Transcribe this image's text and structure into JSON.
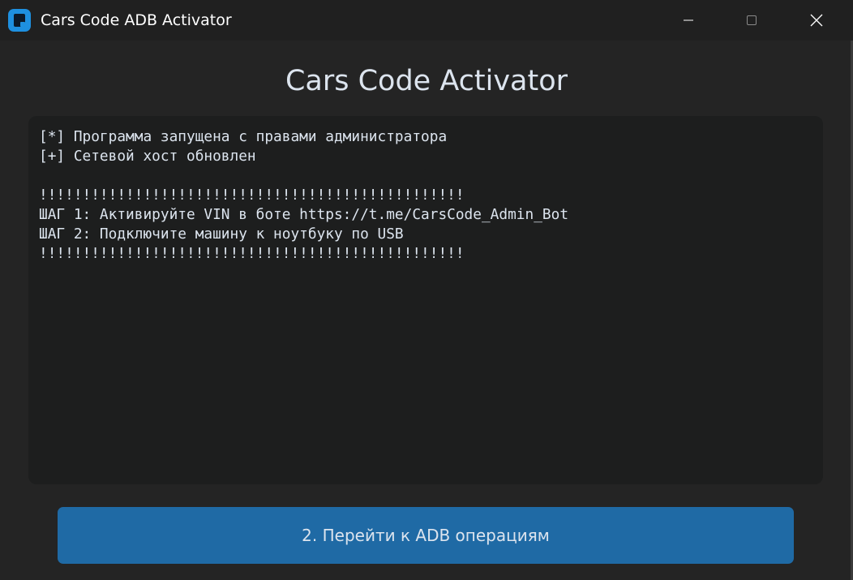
{
  "window": {
    "title": "Cars Code ADB Activator",
    "icon": "app-logo-icon",
    "controls": {
      "minimize_icon": "minimize-icon",
      "maximize_icon": "maximize-icon",
      "close_icon": "close-icon"
    }
  },
  "main": {
    "heading": "Cars Code Activator",
    "console": {
      "lines": [
        "[*] Программа запущена с правами администратора",
        "[+] Сетевой хост обновлен",
        "",
        "!!!!!!!!!!!!!!!!!!!!!!!!!!!!!!!!!!!!!!!!!!!!!!!!!",
        "ШАГ 1: Активируйте VIN в боте https://t.me/CarsCode_Admin_Bot",
        "ШАГ 2: Подключите машину к ноутбуку по USB",
        "!!!!!!!!!!!!!!!!!!!!!!!!!!!!!!!!!!!!!!!!!!!!!!!!!"
      ]
    },
    "action_button": {
      "label": "2. Перейти к ADB операциям"
    }
  },
  "colors": {
    "window_bg": "#242424",
    "titlebar_bg": "#202020",
    "console_bg": "#1d1e1e",
    "text": "#dce4ee",
    "accent": "#1f6aa5",
    "icon_blue": "#1e90e0"
  }
}
